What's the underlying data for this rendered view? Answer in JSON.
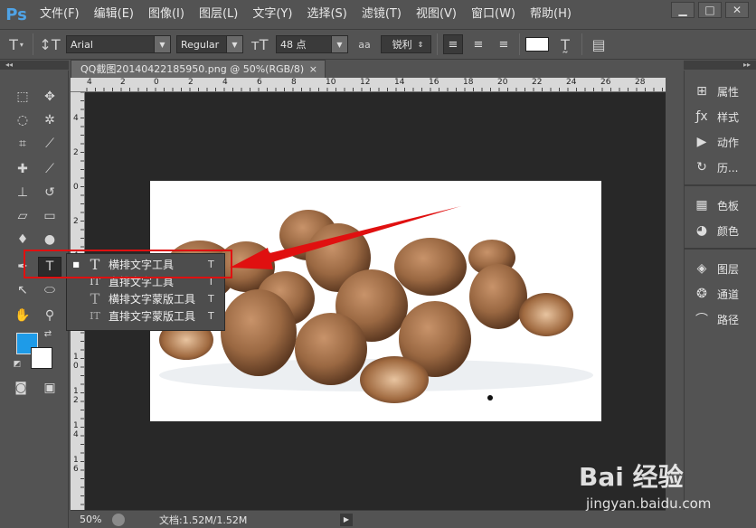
{
  "app": {
    "logo": "Ps"
  },
  "menubar": {
    "items": [
      "文件(F)",
      "编辑(E)",
      "图像(I)",
      "图层(L)",
      "文字(Y)",
      "选择(S)",
      "滤镜(T)",
      "视图(V)",
      "窗口(W)",
      "帮助(H)"
    ],
    "controls": {
      "minimize": "▁",
      "maximize": "□",
      "close": "✕"
    }
  },
  "options": {
    "font_family": "Arial",
    "font_style": "Regular",
    "font_size": "48 点",
    "aa_label": "aa",
    "antialias": "锐利"
  },
  "document": {
    "tab_title": "QQ截图20140422185950.png @ 50%(RGB/8)",
    "tab_close": "×",
    "ruler_top": [
      "4",
      "2",
      "0",
      "2",
      "4",
      "6",
      "8",
      "10",
      "12",
      "14",
      "16",
      "18",
      "20",
      "22",
      "24",
      "26",
      "28"
    ],
    "ruler_left": [
      "4",
      "2",
      "0",
      "2",
      "4",
      "6",
      "8",
      "1\n0",
      "1\n2",
      "1\n4",
      "1\n6"
    ]
  },
  "status": {
    "zoom": "50%",
    "doc_info": "文档:1.52M/1.52M"
  },
  "flyout": {
    "items": [
      {
        "icon": "T",
        "label": "横排文字工具",
        "key": "T",
        "active": true
      },
      {
        "icon": "IT",
        "label": "直排文字工具",
        "key": "T",
        "active": false
      },
      {
        "icon": "T",
        "label": "横排文字蒙版工具",
        "key": "T",
        "active": false
      },
      {
        "icon": "IT",
        "label": "直排文字蒙版工具",
        "key": "T",
        "active": false
      }
    ]
  },
  "panels": {
    "group1": [
      "属性",
      "样式",
      "动作",
      "历..."
    ],
    "group2": [
      "色板",
      "颜色"
    ],
    "group3": [
      "图层",
      "通道",
      "路径"
    ]
  },
  "colors": {
    "foreground": "#1e9be8",
    "background": "#ffffff",
    "accent": "#e01010"
  },
  "watermark": {
    "main": "Bai 经验",
    "sub": "jingyan.baidu.com"
  }
}
